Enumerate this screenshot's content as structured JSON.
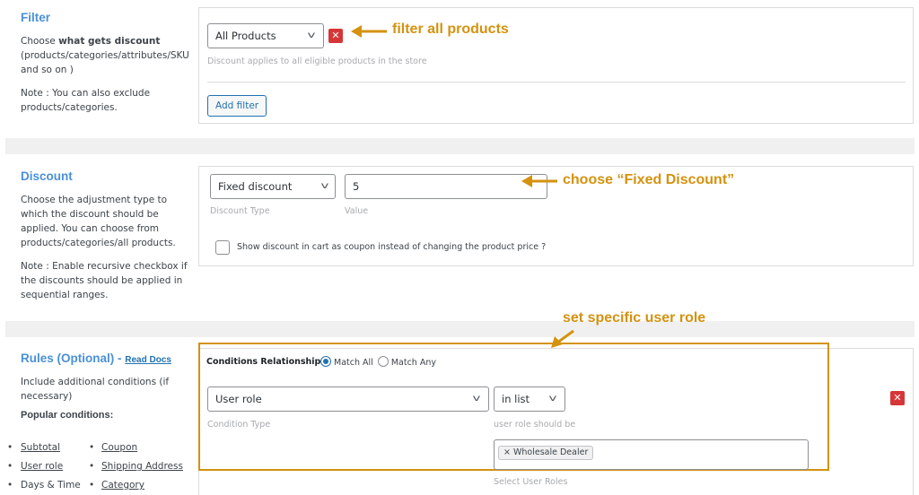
{
  "filter": {
    "title": "Filter",
    "desc_pre": "Choose ",
    "desc_bold": "what gets discount",
    "desc_post": " (products/categories/attributes/SKU and so on )",
    "note": "Note : You can also exclude products/categories.",
    "select_value": "All Products",
    "hint": "Discount applies to all eligible products in the store",
    "add_button": "Add filter",
    "annotation": "filter all products"
  },
  "discount": {
    "title": "Discount",
    "desc": "Choose the adjustment type to which the discount should be applied. You can choose from products/categories/all products.",
    "note": "Note : Enable recursive checkbox if the discounts should be applied in sequential ranges.",
    "type_value": "Fixed discount",
    "type_hint": "Discount Type",
    "value": "5",
    "value_hint": "Value",
    "checkbox_label": "Show discount in cart as coupon instead of changing the product price ?",
    "annotation": "choose “Fixed Discount”"
  },
  "rules": {
    "title": "Rules (Optional) -",
    "read_docs": "Read Docs",
    "desc": "Include additional conditions (if necessary)",
    "popular_title": "Popular conditions:",
    "popular": [
      "Subtotal",
      "Coupon",
      "User role",
      "Shipping Address",
      "Days & Time",
      "Category"
    ],
    "conditions_label": "Conditions Relationship",
    "match_all": "Match All",
    "match_any": "Match Any",
    "condition_type_value": "User role",
    "condition_type_hint": "Condition Type",
    "operator_value": "in list",
    "operator_hint": "user role should be",
    "role_tag": "Wholesale Dealer",
    "role_hint": "Select User Roles",
    "annotation": "set specific user role"
  },
  "colors": {
    "annotation": "#d4920f",
    "section_title": "#4a90d9",
    "remove": "#d63638",
    "primary": "#2271b1"
  }
}
